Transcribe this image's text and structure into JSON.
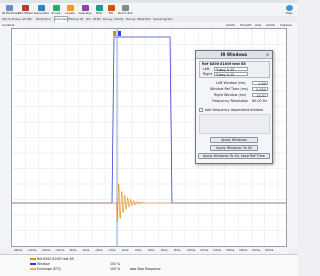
{
  "toolbar": {
    "items": [
      {
        "label": "IR Windows",
        "icon": "window-icon"
      },
      {
        "label": "SPL Meter",
        "icon": "meter-icon"
      },
      {
        "label": "Generator",
        "icon": "generator-icon"
      },
      {
        "label": "Scope",
        "icon": "scope-icon"
      },
      {
        "label": "Levels",
        "icon": "levels-icon"
      },
      {
        "label": "Overlays",
        "icon": "overlays-icon"
      },
      {
        "label": "RTA",
        "icon": "rta-icon"
      },
      {
        "label": "EQ",
        "icon": "eq-icon"
      },
      {
        "label": "Room Sim",
        "icon": "room-icon"
      }
    ],
    "right_label": "Help"
  },
  "tabs": [
    {
      "label": "SPL & Phase",
      "active": false
    },
    {
      "label": "All SPL",
      "active": false
    },
    {
      "label": "Distortion",
      "active": false
    },
    {
      "label": "Impulse",
      "active": true
    },
    {
      "label": "Filtered IR",
      "active": false
    },
    {
      "label": "GD",
      "active": false
    },
    {
      "label": "RT60",
      "active": false
    },
    {
      "label": "Decay",
      "active": false
    },
    {
      "label": "Clarity",
      "active": false
    },
    {
      "label": "Decay",
      "active": false
    },
    {
      "label": "Waterfall",
      "active": false
    },
    {
      "label": "Spectrogram",
      "active": false
    }
  ],
  "subbar": {
    "left": "Controls",
    "right_items": [
      "Limits",
      "Smooth",
      "Axis",
      "Limits",
      "Capture"
    ]
  },
  "dialog": {
    "title": "IR Windows",
    "measurement": "Ref 8200 8100f test 85",
    "left_label": "Left",
    "left_value": "Tukey 0.25",
    "right_label": "Right",
    "right_value": "Tukey 0.25",
    "left_window_label": "Left Window (ms)",
    "left_window_value": "0.50",
    "window_ref_label": "Window Ref Time (ms)",
    "window_ref_value": "0.000",
    "right_window_label": "Right Window (ms)",
    "right_window_value": "14.01",
    "freq_resolution_label": "Frequency Resolution",
    "freq_resolution_value": "60.00 Hz",
    "freq_dependent_label": "Add frequency dependent window",
    "apply_label": "Apply Windows",
    "apply_all_label": "Apply Windows To All",
    "apply_all_keep_label": "Apply Windows To All, keep Ref Time"
  },
  "x_ticks": [
    "-16ms",
    "-14ms",
    "-12ms",
    "-10ms",
    "-8ms",
    "-6ms",
    "-4ms",
    "-2ms",
    "0ms",
    "2ms",
    "4ms",
    "6ms",
    "8ms",
    "10ms",
    "12ms",
    "14ms",
    "16ms",
    "18ms",
    "20ms",
    "22ms"
  ],
  "legend": [
    {
      "label": "Ref 8200 8100f test 85",
      "color": "#e89010",
      "value": ""
    },
    {
      "label": "Window",
      "color": "#3040d0",
      "value": "100 %"
    },
    {
      "label": "Envelope (ETC)",
      "color": "#f0b040",
      "value": "100 %"
    },
    {
      "label": "Step Response",
      "color": "#90a0b0",
      "value": ""
    }
  ],
  "colors": {
    "impulse": "#e88a10",
    "window": "#3a3fd8",
    "ref_line": "#4a8fd0"
  }
}
